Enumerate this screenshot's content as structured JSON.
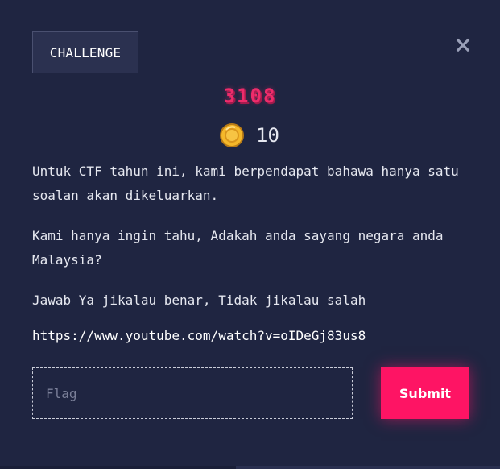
{
  "modal": {
    "tab_label": "CHALLENGE",
    "close_icon": "close-icon",
    "title": "3108",
    "points": {
      "icon": "coin-icon",
      "value": "10"
    },
    "description": [
      "Untuk CTF tahun ini, kami berpendapat bahawa hanya satu soalan akan dikeluarkan.",
      "Kami hanya ingin tahu, Adakah anda sayang negara anda Malaysia?",
      "Jawab Ya jikalau benar, Tidak jikalau salah"
    ],
    "link": "https://www.youtube.com/watch?v=oIDeGj83us8",
    "flag_input": {
      "placeholder": "Flag",
      "value": ""
    },
    "submit_label": "Submit"
  },
  "colors": {
    "background": "#1f2541",
    "title": "#ee2c6b",
    "submit": "#fe1464",
    "tab_bg": "#2b3150"
  }
}
